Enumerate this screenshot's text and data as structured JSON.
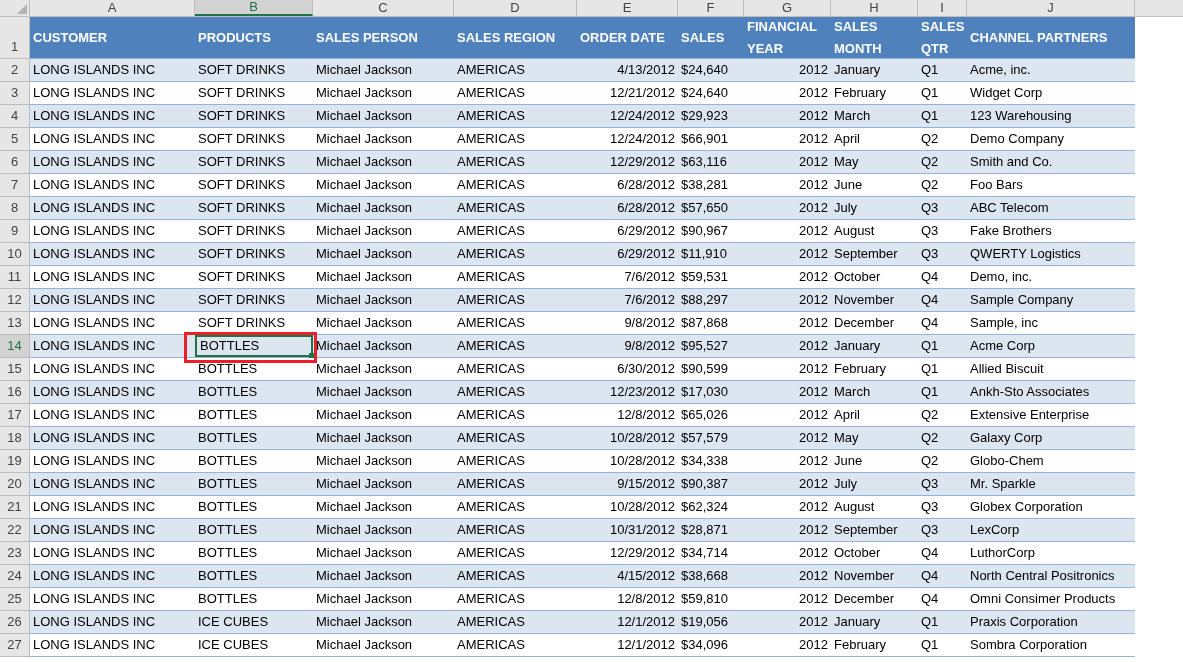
{
  "columns": [
    {
      "letter": "A",
      "selected": false
    },
    {
      "letter": "B",
      "selected": true
    },
    {
      "letter": "C",
      "selected": false
    },
    {
      "letter": "D",
      "selected": false
    },
    {
      "letter": "E",
      "selected": false
    },
    {
      "letter": "F",
      "selected": false
    },
    {
      "letter": "G",
      "selected": false
    },
    {
      "letter": "H",
      "selected": false
    },
    {
      "letter": "I",
      "selected": false
    },
    {
      "letter": "J",
      "selected": false
    }
  ],
  "header_row": {
    "number": "1",
    "cells": [
      "CUSTOMER",
      "PRODUCTS",
      "SALES PERSON",
      "SALES REGION",
      "ORDER DATE",
      "SALES",
      "FINANCIAL YEAR",
      "SALES MONTH",
      "SALES QTR",
      "CHANNEL PARTNERS"
    ]
  },
  "rows": [
    {
      "number": "2",
      "selected": false,
      "cells": [
        "LONG ISLANDS INC",
        "SOFT DRINKS",
        "Michael Jackson",
        "AMERICAS",
        "4/13/2012",
        "$24,640",
        "2012",
        "January",
        "Q1",
        "Acme, inc."
      ]
    },
    {
      "number": "3",
      "selected": false,
      "cells": [
        "LONG ISLANDS INC",
        "SOFT DRINKS",
        "Michael Jackson",
        "AMERICAS",
        "12/21/2012",
        "$24,640",
        "2012",
        "February",
        "Q1",
        "Widget Corp"
      ]
    },
    {
      "number": "4",
      "selected": false,
      "cells": [
        "LONG ISLANDS INC",
        "SOFT DRINKS",
        "Michael Jackson",
        "AMERICAS",
        "12/24/2012",
        "$29,923",
        "2012",
        "March",
        "Q1",
        "123 Warehousing"
      ]
    },
    {
      "number": "5",
      "selected": false,
      "cells": [
        "LONG ISLANDS INC",
        "SOFT DRINKS",
        "Michael Jackson",
        "AMERICAS",
        "12/24/2012",
        "$66,901",
        "2012",
        "April",
        "Q2",
        "Demo Company"
      ]
    },
    {
      "number": "6",
      "selected": false,
      "cells": [
        "LONG ISLANDS INC",
        "SOFT DRINKS",
        "Michael Jackson",
        "AMERICAS",
        "12/29/2012",
        "$63,116",
        "2012",
        "May",
        "Q2",
        "Smith and Co."
      ]
    },
    {
      "number": "7",
      "selected": false,
      "cells": [
        "LONG ISLANDS INC",
        "SOFT DRINKS",
        "Michael Jackson",
        "AMERICAS",
        "6/28/2012",
        "$38,281",
        "2012",
        "June",
        "Q2",
        "Foo Bars"
      ]
    },
    {
      "number": "8",
      "selected": false,
      "cells": [
        "LONG ISLANDS INC",
        "SOFT DRINKS",
        "Michael Jackson",
        "AMERICAS",
        "6/28/2012",
        "$57,650",
        "2012",
        "July",
        "Q3",
        "ABC Telecom"
      ]
    },
    {
      "number": "9",
      "selected": false,
      "cells": [
        "LONG ISLANDS INC",
        "SOFT DRINKS",
        "Michael Jackson",
        "AMERICAS",
        "6/29/2012",
        "$90,967",
        "2012",
        "August",
        "Q3",
        "Fake Brothers"
      ]
    },
    {
      "number": "10",
      "selected": false,
      "cells": [
        "LONG ISLANDS INC",
        "SOFT DRINKS",
        "Michael Jackson",
        "AMERICAS",
        "6/29/2012",
        "$11,910",
        "2012",
        "September",
        "Q3",
        "QWERTY Logistics"
      ]
    },
    {
      "number": "11",
      "selected": false,
      "cells": [
        "LONG ISLANDS INC",
        "SOFT DRINKS",
        "Michael Jackson",
        "AMERICAS",
        "7/6/2012",
        "$59,531",
        "2012",
        "October",
        "Q4",
        "Demo, inc."
      ]
    },
    {
      "number": "12",
      "selected": false,
      "cells": [
        "LONG ISLANDS INC",
        "SOFT DRINKS",
        "Michael Jackson",
        "AMERICAS",
        "7/6/2012",
        "$88,297",
        "2012",
        "November",
        "Q4",
        "Sample Company"
      ]
    },
    {
      "number": "13",
      "selected": false,
      "cells": [
        "LONG ISLANDS INC",
        "SOFT DRINKS",
        "Michael Jackson",
        "AMERICAS",
        "9/8/2012",
        "$87,868",
        "2012",
        "December",
        "Q4",
        "Sample, inc"
      ]
    },
    {
      "number": "14",
      "selected": true,
      "cells": [
        "LONG ISLANDS INC",
        "BOTTLES",
        "Michael Jackson",
        "AMERICAS",
        "9/8/2012",
        "$95,527",
        "2012",
        "January",
        "Q1",
        "Acme Corp"
      ]
    },
    {
      "number": "15",
      "selected": false,
      "cells": [
        "LONG ISLANDS INC",
        "BOTTLES",
        "Michael Jackson",
        "AMERICAS",
        "6/30/2012",
        "$90,599",
        "2012",
        "February",
        "Q1",
        "Allied Biscuit"
      ]
    },
    {
      "number": "16",
      "selected": false,
      "cells": [
        "LONG ISLANDS INC",
        "BOTTLES",
        "Michael Jackson",
        "AMERICAS",
        "12/23/2012",
        "$17,030",
        "2012",
        "March",
        "Q1",
        "Ankh-Sto Associates"
      ]
    },
    {
      "number": "17",
      "selected": false,
      "cells": [
        "LONG ISLANDS INC",
        "BOTTLES",
        "Michael Jackson",
        "AMERICAS",
        "12/8/2012",
        "$65,026",
        "2012",
        "April",
        "Q2",
        "Extensive Enterprise"
      ]
    },
    {
      "number": "18",
      "selected": false,
      "cells": [
        "LONG ISLANDS INC",
        "BOTTLES",
        "Michael Jackson",
        "AMERICAS",
        "10/28/2012",
        "$57,579",
        "2012",
        "May",
        "Q2",
        "Galaxy Corp"
      ]
    },
    {
      "number": "19",
      "selected": false,
      "cells": [
        "LONG ISLANDS INC",
        "BOTTLES",
        "Michael Jackson",
        "AMERICAS",
        "10/28/2012",
        "$34,338",
        "2012",
        "June",
        "Q2",
        "Globo-Chem"
      ]
    },
    {
      "number": "20",
      "selected": false,
      "cells": [
        "LONG ISLANDS INC",
        "BOTTLES",
        "Michael Jackson",
        "AMERICAS",
        "9/15/2012",
        "$90,387",
        "2012",
        "July",
        "Q3",
        "Mr. Sparkle"
      ]
    },
    {
      "number": "21",
      "selected": false,
      "cells": [
        "LONG ISLANDS INC",
        "BOTTLES",
        "Michael Jackson",
        "AMERICAS",
        "10/28/2012",
        "$62,324",
        "2012",
        "August",
        "Q3",
        "Globex Corporation"
      ]
    },
    {
      "number": "22",
      "selected": false,
      "cells": [
        "LONG ISLANDS INC",
        "BOTTLES",
        "Michael Jackson",
        "AMERICAS",
        "10/31/2012",
        "$28,871",
        "2012",
        "September",
        "Q3",
        "LexCorp"
      ]
    },
    {
      "number": "23",
      "selected": false,
      "cells": [
        "LONG ISLANDS INC",
        "BOTTLES",
        "Michael Jackson",
        "AMERICAS",
        "12/29/2012",
        "$34,714",
        "2012",
        "October",
        "Q4",
        "LuthorCorp"
      ]
    },
    {
      "number": "24",
      "selected": false,
      "cells": [
        "LONG ISLANDS INC",
        "BOTTLES",
        "Michael Jackson",
        "AMERICAS",
        "4/15/2012",
        "$38,668",
        "2012",
        "November",
        "Q4",
        "North Central Positronics"
      ]
    },
    {
      "number": "25",
      "selected": false,
      "cells": [
        "LONG ISLANDS INC",
        "BOTTLES",
        "Michael Jackson",
        "AMERICAS",
        "12/8/2012",
        "$59,810",
        "2012",
        "December",
        "Q4",
        "Omni Consimer Products"
      ]
    },
    {
      "number": "26",
      "selected": false,
      "cells": [
        "LONG ISLANDS INC",
        "ICE CUBES",
        "Michael Jackson",
        "AMERICAS",
        "12/1/2012",
        "$19,056",
        "2012",
        "January",
        "Q1",
        "Praxis Corporation"
      ]
    },
    {
      "number": "27",
      "selected": false,
      "cells": [
        "LONG ISLANDS INC",
        "ICE CUBES",
        "Michael Jackson",
        "AMERICAS",
        "12/1/2012",
        "$34,096",
        "2012",
        "February",
        "Q1",
        "Sombra Corporation"
      ]
    }
  ]
}
